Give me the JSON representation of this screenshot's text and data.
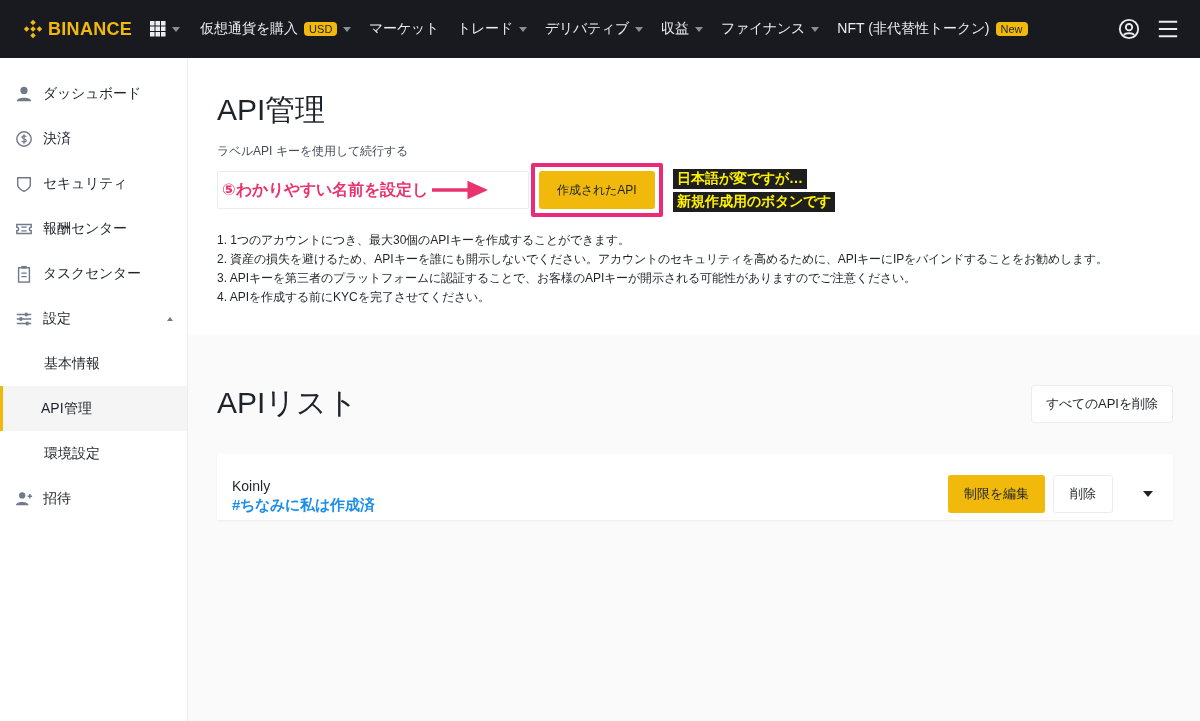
{
  "top_nav": {
    "logo": "BINANCE",
    "apps_menu": {
      "dropdown": true
    },
    "items": [
      {
        "label": "仮想通貨を購入",
        "badge": "USD",
        "dropdown": true
      },
      {
        "label": "マーケット",
        "dropdown": false
      },
      {
        "label": "トレード",
        "dropdown": true
      },
      {
        "label": "デリバティブ",
        "dropdown": true
      },
      {
        "label": "収益",
        "dropdown": true
      },
      {
        "label": "ファイナンス",
        "dropdown": true
      },
      {
        "label": "NFT (非代替性トークン)",
        "badge": "New",
        "dropdown": false
      }
    ]
  },
  "sidebar": {
    "items": [
      {
        "label": "ダッシュボード"
      },
      {
        "label": "決済"
      },
      {
        "label": "セキュリティ"
      },
      {
        "label": "報酬センター"
      },
      {
        "label": "タスクセンター"
      },
      {
        "label": "設定",
        "expanded": true,
        "children": [
          {
            "label": "基本情報",
            "selected": false
          },
          {
            "label": "API管理",
            "selected": true
          },
          {
            "label": "環境設定",
            "selected": false
          }
        ]
      },
      {
        "label": "招待"
      }
    ]
  },
  "api_create": {
    "title": "API管理",
    "field_label": "ラベルAPI キーを使用して続行する",
    "field_note": "⑤わかりやすい名前を設定し",
    "button": "作成されたAPI",
    "callout": [
      "日本語が変ですが…",
      "新規作成用のボタンです"
    ],
    "notes": [
      "1. 1つのアカウントにつき、最大30個のAPIキーを作成することができます。",
      "2. 資産の損失を避けるため、APIキーを誰にも開示しないでください。アカウントのセキュリティを高めるために、APIキーにIPをバインドすることをお勧めします。",
      "3. APIキーを第三者のプラットフォームに認証することで、お客様のAPIキーが開示される可能性がありますのでご注意ください。",
      "4. APIを作成する前にKYCを完了させてください。"
    ]
  },
  "api_list": {
    "title": "APIリスト",
    "delete_all_button": "すべてのAPIを削除",
    "rows": [
      {
        "name": "Koinly",
        "note": "#ちなみに私は作成済",
        "edit_button": "制限を編集",
        "delete_button": "削除",
        "expanded": false
      }
    ]
  }
}
